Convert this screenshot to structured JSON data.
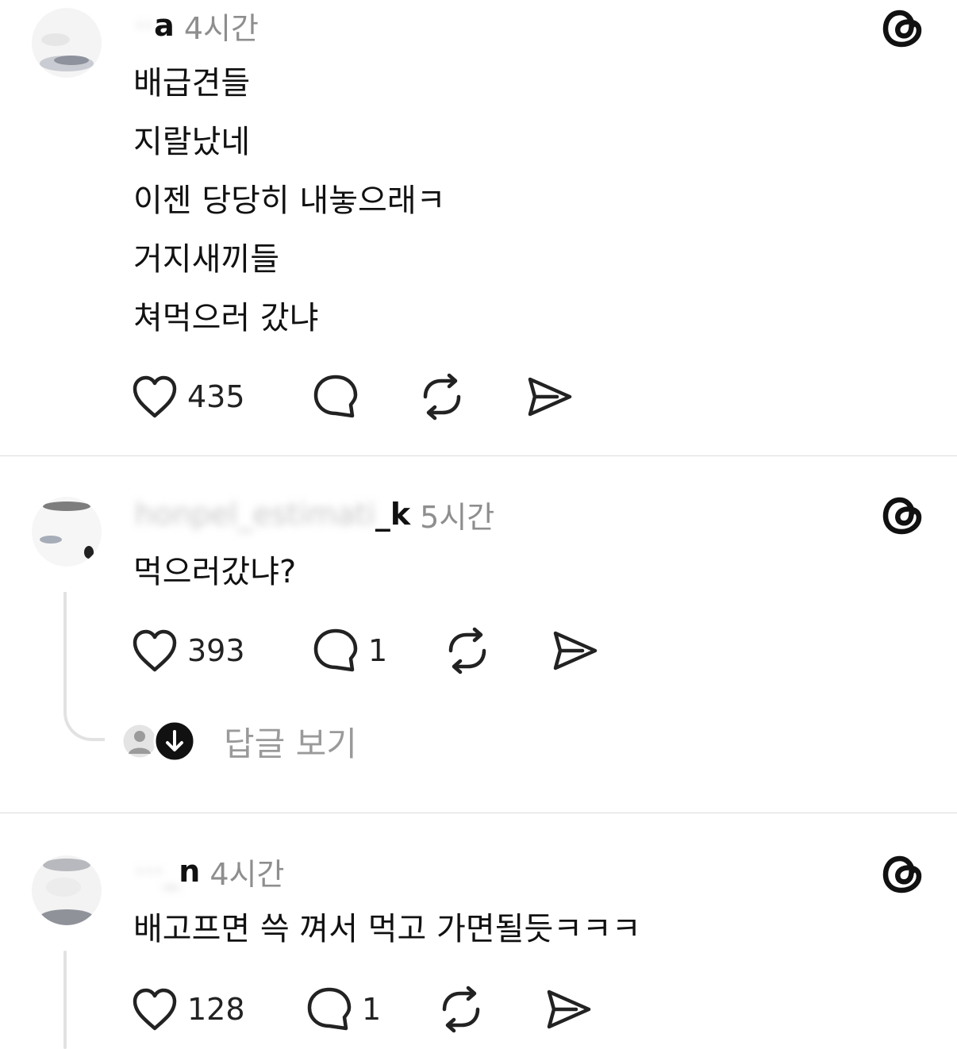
{
  "posts": [
    {
      "username_blurred": "··",
      "username_visible": "a",
      "time": "4시간",
      "lines": [
        "배급견들",
        "지랄났네",
        "이젠 당당히 내놓으래ㅋ",
        "거지새끼들",
        "쳐먹으러 갔냐"
      ],
      "likes": "435",
      "replies": ""
    },
    {
      "username_blurred": "honpel_estimati",
      "username_visible": "_k",
      "time": "5시간",
      "lines": [
        "먹으러갔냐?"
      ],
      "likes": "393",
      "replies": "1",
      "view_replies": "답글 보기"
    },
    {
      "username_blurred": "···_",
      "username_visible": "n",
      "time": "4시간",
      "lines": [
        "배고프면 쓱 껴서 먹고 가면될듯ㅋㅋㅋ"
      ],
      "likes": "128",
      "replies": "1"
    }
  ],
  "icons": {
    "like": "heart-icon",
    "comment": "comment-bubble-icon",
    "repost": "repost-icon",
    "share": "send-icon",
    "brand": "threads-logo-icon"
  }
}
